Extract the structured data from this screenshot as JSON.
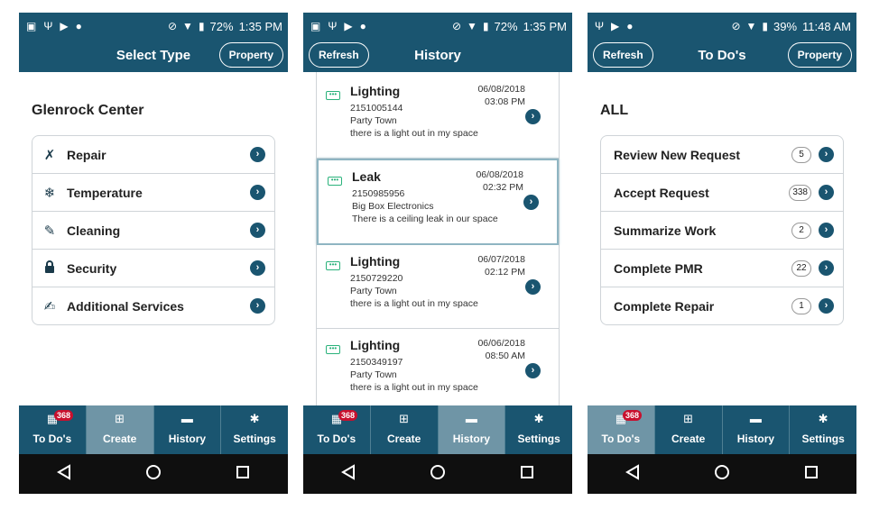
{
  "screens": [
    {
      "status": {
        "battery": "72%",
        "time": "1:35 PM"
      },
      "title": "Select Type",
      "right_button": "Property",
      "heading": "Glenrock Center",
      "menu": [
        {
          "label": "Repair",
          "icon": "tools-icon",
          "glyph": "✗"
        },
        {
          "label": "Temperature",
          "icon": "temperature-icon",
          "glyph": "❄"
        },
        {
          "label": "Cleaning",
          "icon": "cleaning-icon",
          "glyph": "✎"
        },
        {
          "label": "Security",
          "icon": "lock-icon",
          "glyph": "🔒"
        },
        {
          "label": "Additional Services",
          "icon": "edit-icon",
          "glyph": "✍"
        }
      ],
      "active_tab": "Create"
    },
    {
      "status": {
        "battery": "72%",
        "time": "1:35 PM"
      },
      "title": "History",
      "left_button": "Refresh",
      "history": [
        {
          "type": "Lighting",
          "id": "2151005144",
          "location": "Party Town",
          "description": "there is a light out in my space",
          "date": "06/08/2018",
          "time": "03:08 PM"
        },
        {
          "type": "Leak",
          "id": "2150985956",
          "location": "Big Box Electronics",
          "description": "There is a ceiling leak in our space",
          "date": "06/08/2018",
          "time": "02:32 PM"
        },
        {
          "type": "Lighting",
          "id": "2150729220",
          "location": "Party Town",
          "description": "there is a light out in my space",
          "date": "06/07/2018",
          "time": "02:12 PM"
        },
        {
          "type": "Lighting",
          "id": "2150349197",
          "location": "Party Town",
          "description": "there is a light out in my space",
          "date": "06/06/2018",
          "time": "08:50 AM"
        }
      ],
      "active_tab": "History"
    },
    {
      "status": {
        "battery": "39%",
        "time": "11:48 AM"
      },
      "title": "To Do's",
      "left_button": "Refresh",
      "right_button": "Property",
      "heading": "ALL",
      "todos": [
        {
          "label": "Review New Request",
          "count": "5"
        },
        {
          "label": "Accept Request",
          "count": "338"
        },
        {
          "label": "Summarize Work",
          "count": "2"
        },
        {
          "label": "Complete PMR",
          "count": "22"
        },
        {
          "label": "Complete Repair",
          "count": "1"
        }
      ],
      "active_tab": "To Do's"
    }
  ],
  "tabs": [
    {
      "label": "To Do's",
      "icon": "grid-icon",
      "badge": "368"
    },
    {
      "label": "Create",
      "icon": "plus-square-icon"
    },
    {
      "label": "History",
      "icon": "folder-icon"
    },
    {
      "label": "Settings",
      "icon": "gear-icon"
    }
  ],
  "colors": {
    "primary": "#1a5570",
    "active_tab": "#6f95a6",
    "badge": "#c8102e"
  }
}
